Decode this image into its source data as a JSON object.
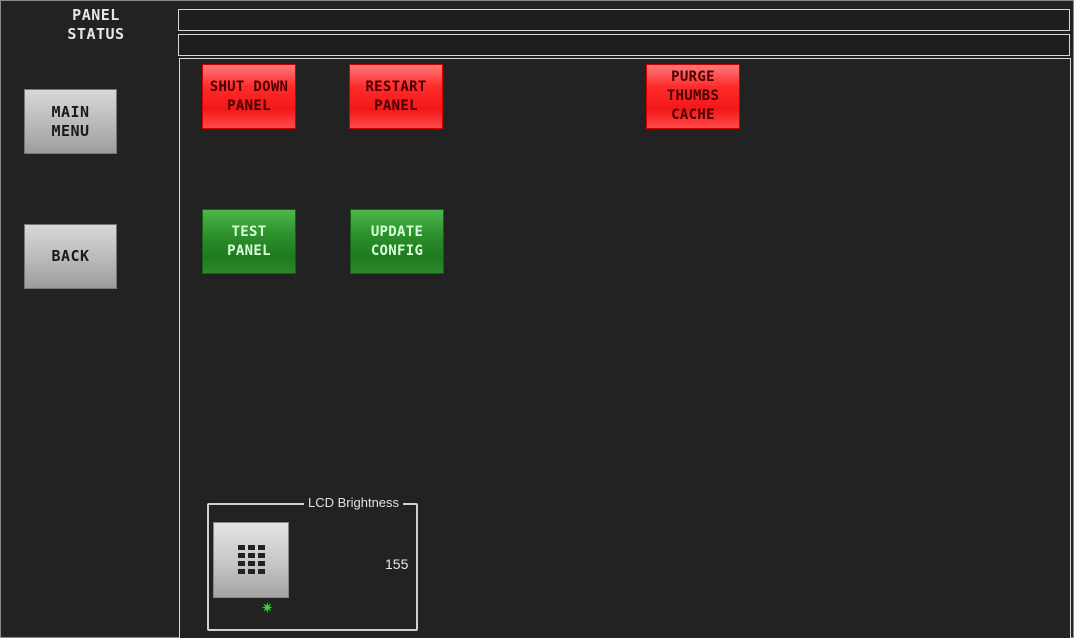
{
  "header": {
    "title": "PANEL\nSTATUS"
  },
  "sidebar": {
    "main_menu_label": "MAIN\nMENU",
    "back_label": "BACK"
  },
  "actions": {
    "shut_down_panel": "SHUT DOWN\nPANEL",
    "restart_panel": "RESTART\nPANEL",
    "purge_thumbs_cache": "PURGE\nTHUMBS\nCACHE",
    "test_panel": "TEST\nPANEL",
    "update_config": "UPDATE\nCONFIG"
  },
  "lcd_brightness": {
    "label": "LCD Brightness",
    "value": "155",
    "keypad_icon": "keypad-icon",
    "status_icon": "green-star-indicator",
    "status_color": "#23e023"
  },
  "colors": {
    "danger": "#f21818",
    "ok": "#2c8f2c",
    "background": "#222222"
  }
}
